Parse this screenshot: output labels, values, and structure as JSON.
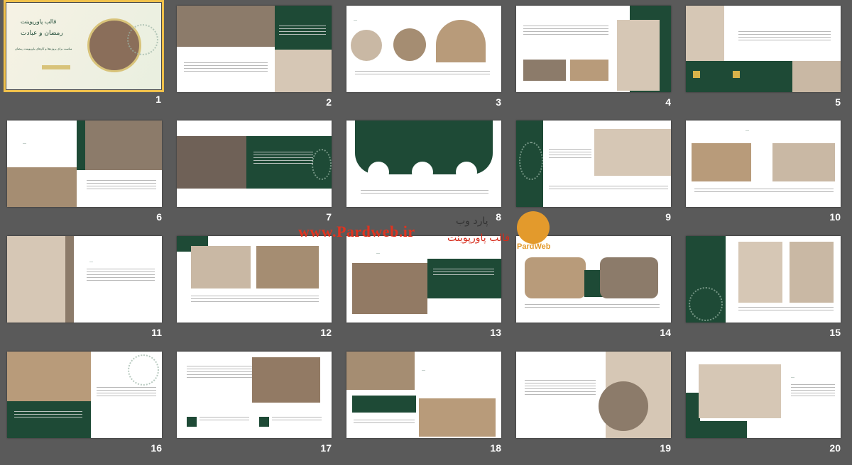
{
  "slides": [
    {
      "number": "1",
      "title_fa": "قالب پاورپوینت",
      "subtitle_fa": "رمضان و عبادت",
      "desc_fa": "مناسب برای پروژه‌ها و کارهای پاورپوینت رمضان",
      "selected": true
    },
    {
      "number": "2"
    },
    {
      "number": "3"
    },
    {
      "number": "4"
    },
    {
      "number": "5"
    },
    {
      "number": "6"
    },
    {
      "number": "7"
    },
    {
      "number": "8"
    },
    {
      "number": "9"
    },
    {
      "number": "10"
    },
    {
      "number": "11"
    },
    {
      "number": "12"
    },
    {
      "number": "13"
    },
    {
      "number": "14"
    },
    {
      "number": "15"
    },
    {
      "number": "16"
    },
    {
      "number": "17"
    },
    {
      "number": "18"
    },
    {
      "number": "19"
    },
    {
      "number": "20"
    }
  ],
  "watermark": {
    "url": "www.Pardweb.ir",
    "fa_top": "پارد وب",
    "fa_bottom": "قالب پاورپوینت",
    "logo_text": "PardWeb"
  },
  "colors": {
    "background": "#5a5a5a",
    "accent_green": "#1e4a36",
    "selected_outline": "#f0c14b",
    "watermark_red": "#e0331f"
  }
}
